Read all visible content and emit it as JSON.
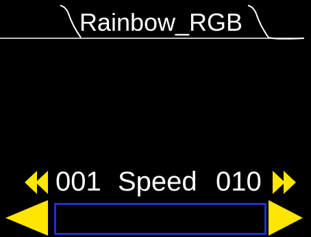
{
  "header": {
    "title": "Rainbow_RGB"
  },
  "speed_control": {
    "min_value": "001",
    "label": "Speed",
    "max_value": "010",
    "decrease_fast_icon": "double-left-arrow-icon",
    "increase_fast_icon": "double-right-arrow-icon"
  },
  "slider": {
    "decrease_icon": "left-triangle-icon",
    "increase_icon": "right-triangle-icon",
    "fill_fraction": 0
  },
  "colors": {
    "background": "#000000",
    "text": "#ffffff",
    "accent": "#ffe600",
    "track_border": "#1f2fd0"
  }
}
